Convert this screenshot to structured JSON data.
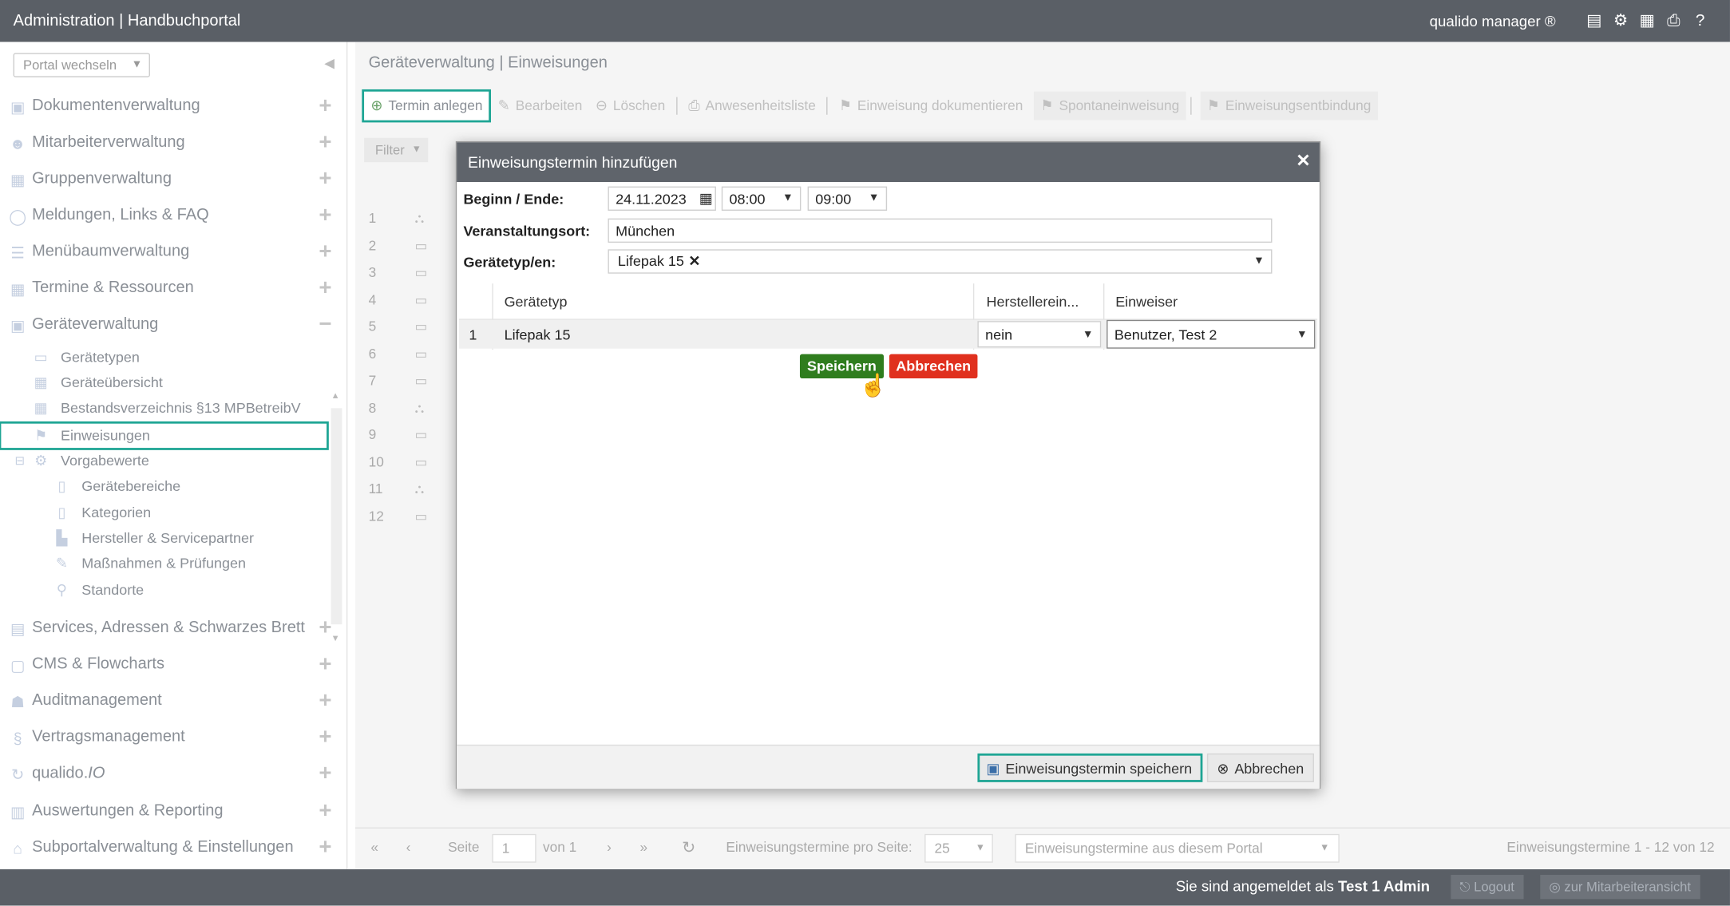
{
  "app": {
    "title": "Administration | Handbuchportal",
    "brand": "qualido manager ®"
  },
  "topbar_icons": [
    "book-icon",
    "network-icon",
    "calendar-icon",
    "print-icon",
    "help-icon"
  ],
  "sidebar": {
    "portal_select": "Portal wechseln",
    "items": [
      {
        "label": "Dokumentenverwaltung",
        "icon": "document-icon",
        "toggle": "+"
      },
      {
        "label": "Mitarbeiterverwaltung",
        "icon": "users-icon",
        "toggle": "+"
      },
      {
        "label": "Gruppenverwaltung",
        "icon": "groups-icon",
        "toggle": "+"
      },
      {
        "label": "Meldungen, Links & FAQ",
        "icon": "chat-icon",
        "toggle": "+"
      },
      {
        "label": "Menübaumverwaltung",
        "icon": "list-icon",
        "toggle": "+"
      },
      {
        "label": "Termine & Ressourcen",
        "icon": "calendar-icon",
        "toggle": "+"
      },
      {
        "label": "Geräteverwaltung",
        "icon": "device-icon",
        "toggle": "−"
      }
    ],
    "subitems": [
      {
        "label": "Gerätetypen",
        "icon": "monitor-icon"
      },
      {
        "label": "Geräteübersicht",
        "icon": "grid-icon"
      },
      {
        "label": "Bestandsverzeichnis §13 MPBetreibV",
        "icon": "grid-icon"
      },
      {
        "label": "Einweisungen",
        "icon": "flag-icon"
      },
      {
        "label": "Vorgabewerte",
        "icon": "gears-icon"
      },
      {
        "label": "Gerätebereiche",
        "icon": "page-icon"
      },
      {
        "label": "Kategorien",
        "icon": "page-icon"
      },
      {
        "label": "Hersteller & Servicepartner",
        "icon": "factory-icon"
      },
      {
        "label": "Maßnahmen & Prüfungen",
        "icon": "wrench-icon"
      },
      {
        "label": "Standorte",
        "icon": "location-icon"
      }
    ],
    "items_bottom": [
      {
        "label": "Services, Adressen & Schwarzes Brett",
        "icon": "board-icon",
        "toggle": "+"
      },
      {
        "label": "CMS & Flowcharts",
        "icon": "cms-icon",
        "toggle": "+"
      },
      {
        "label": "Auditmanagement",
        "icon": "auditor-icon",
        "toggle": "+"
      },
      {
        "label": "Vertragsmanagement",
        "icon": "paragraph-icon",
        "toggle": "+"
      },
      {
        "label": "qualido.",
        "label_em": "IO",
        "icon": "sync-icon",
        "toggle": "+"
      },
      {
        "label": "Auswertungen & Reporting",
        "icon": "chart-icon",
        "toggle": "+"
      },
      {
        "label": "Subportalverwaltung & Einstellungen",
        "icon": "home-icon",
        "toggle": "+"
      }
    ]
  },
  "main": {
    "breadcrumb": "Geräteverwaltung | Einweisungen",
    "toolbar": {
      "add": "Termin anlegen",
      "edit": "Bearbeiten",
      "delete": "Löschen",
      "attendance": "Anwesenheitsliste",
      "document": "Einweisung dokumentieren",
      "spontaneous": "Spontaneinweisung",
      "release": "Einweisungsentbindung"
    },
    "filter": "Filter",
    "row_numbers": [
      "1",
      "2",
      "3",
      "4",
      "5",
      "6",
      "7",
      "8",
      "9",
      "10",
      "11",
      "12"
    ]
  },
  "pager": {
    "page_label": "Seite",
    "page_value": "1",
    "of_label": "von 1",
    "per_page_label": "Einweisungstermine pro Seite:",
    "per_page_value": "25",
    "scope_select": "Einweisungstermine aus diesem Portal",
    "summary": "Einweisungstermine 1 - 12 von 12"
  },
  "dialog": {
    "title": "Einweisungstermin hinzufügen",
    "close": "✕",
    "begin_end_label": "Beginn / Ende:",
    "date": "24.11.2023",
    "start_time": "08:00",
    "end_time": "09:00",
    "location_label": "Veranstaltungsort:",
    "location": "München",
    "devicetype_label": "Gerätetyp/en:",
    "devicetype_tag": "Lifepak 15",
    "grid": {
      "columns": [
        "Gerätetyp",
        "Herstellerein...",
        "Einweiser"
      ],
      "row": {
        "num": "1",
        "devicetype": "Lifepak 15",
        "manufacturer": "nein",
        "instructor": "Benutzer, Test 2"
      }
    },
    "row_save": "Speichern",
    "row_cancel": "Abbrechen",
    "footer_save": "Einweisungstermin speichern",
    "footer_cancel": "Abbrechen"
  },
  "bottombar": {
    "logged_in_prefix": "Sie sind angemeldet als",
    "user": "Test 1 Admin",
    "logout": "Logout",
    "employee_view": "zur Mitarbeiteransicht"
  }
}
